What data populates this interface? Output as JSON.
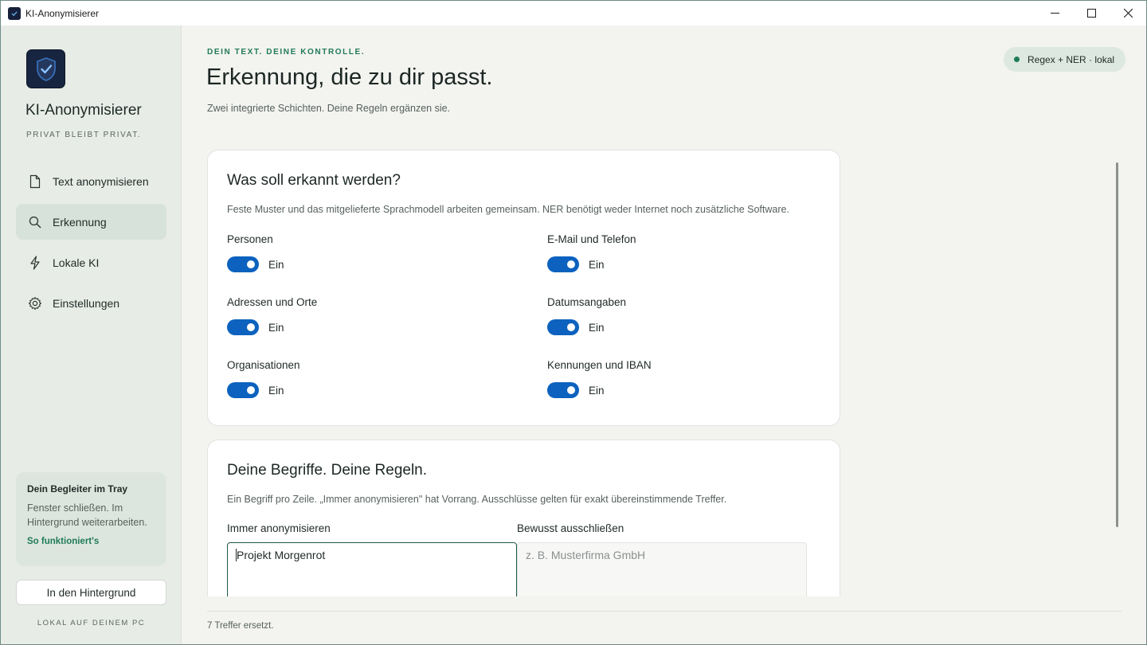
{
  "window": {
    "title": "KI-Anonymisierer"
  },
  "sidebar": {
    "brand_name": "KI-Anonymisierer",
    "brand_tagline": "PRIVAT BLEIBT PRIVAT.",
    "nav": [
      {
        "label": "Text anonymisieren",
        "icon": "document-icon",
        "active": false
      },
      {
        "label": "Erkennung",
        "icon": "search-icon",
        "active": true
      },
      {
        "label": "Lokale KI",
        "icon": "lightning-icon",
        "active": false
      },
      {
        "label": "Einstellungen",
        "icon": "gear-icon",
        "active": false
      }
    ],
    "tray_card": {
      "title": "Dein Begleiter im Tray",
      "text": "Fenster schließen. Im Hintergrund weiterarbeiten.",
      "link": "So funktioniert's"
    },
    "background_button": "In den Hintergrund",
    "footer": "LOKAL AUF DEINEM PC"
  },
  "header": {
    "eyebrow": "DEIN TEXT. DEINE KONTROLLE.",
    "title": "Erkennung, die zu dir passt.",
    "subtitle": "Zwei integrierte Schichten. Deine Regeln ergänzen sie.",
    "status_pill": "Regex + NER · lokal"
  },
  "detection_card": {
    "title": "Was soll erkannt werden?",
    "description": "Feste Muster und das mitgelieferte Sprachmodell arbeiten gemeinsam. NER benötigt weder Internet noch zusätzliche Software.",
    "toggles": [
      {
        "label": "Personen",
        "state": "Ein",
        "on": true
      },
      {
        "label": "E-Mail und Telefon",
        "state": "Ein",
        "on": true
      },
      {
        "label": "Adressen und Orte",
        "state": "Ein",
        "on": true
      },
      {
        "label": "Datumsangaben",
        "state": "Ein",
        "on": true
      },
      {
        "label": "Organisationen",
        "state": "Ein",
        "on": true
      },
      {
        "label": "Kennungen und IBAN",
        "state": "Ein",
        "on": true
      }
    ]
  },
  "rules_card": {
    "title": "Deine Begriffe. Deine Regeln.",
    "description": "Ein Begriff pro Zeile. „Immer anonymisieren\" hat Vorrang. Ausschlüsse gelten für exakt übereinstimmende Treffer.",
    "always_label": "Immer anonymisieren",
    "always_value": "Projekt Morgenrot",
    "exclude_label": "Bewusst ausschließen",
    "exclude_placeholder": "z. B. Musterfirma GmbH"
  },
  "statusbar": {
    "text": "7 Treffer ersetzt."
  },
  "colors": {
    "accent": "#0c62be",
    "brand_green": "#217a5a",
    "logo_bg": "#172540"
  }
}
